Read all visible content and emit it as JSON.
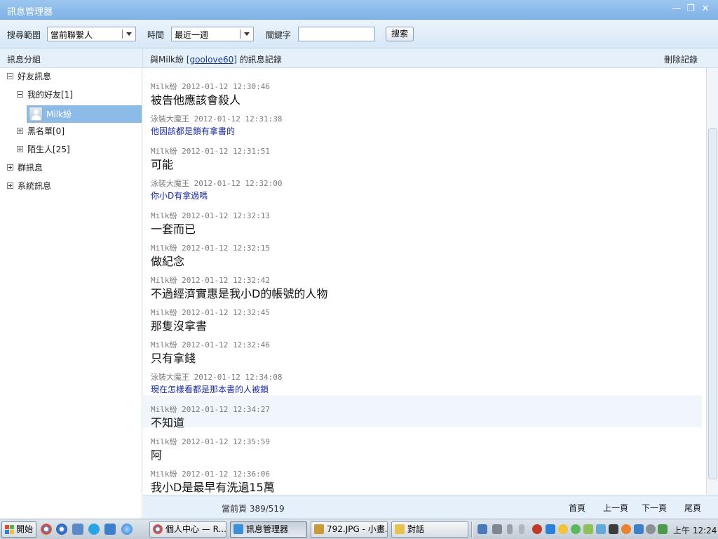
{
  "window": {
    "title": "訊息管理器",
    "minimize": "—",
    "restore": "❐",
    "close": "✕"
  },
  "toolbar": {
    "scope_label": "搜尋範圍",
    "scope_value": "當前聯繫人",
    "time_label": "時間",
    "time_value": "最近一週",
    "keyword_label": "關鍵字",
    "keyword_value": "",
    "search_button": "搜索"
  },
  "sidebar": {
    "header": "訊息分組",
    "tree": {
      "friends": "好友訊息",
      "my_friends": "我的好友[1]",
      "selected_contact": "Milk紛",
      "blacklist": "黑名單[0]",
      "strangers": "陌生人[25]",
      "groups": "群訊息",
      "system": "系統訊息"
    }
  },
  "conversation": {
    "prefix": "與Milk紛",
    "contact_id": "[goolove60]",
    "suffix": "的訊息記錄",
    "delete_button": "刪除記錄"
  },
  "messages": [
    {
      "sender": "Milk紛",
      "time": "2012-01-12 12:30:46",
      "text": "被告他應該會殺人",
      "style": "big"
    },
    {
      "sender": "泳裝大魔王",
      "time": "2012-01-12 12:31:38",
      "text": "他因該都是鎖有拿書的",
      "style": "small"
    },
    {
      "sender": "Milk紛",
      "time": "2012-01-12 12:31:51",
      "text": "可能",
      "style": "big"
    },
    {
      "sender": "泳裝大魔王",
      "time": "2012-01-12 12:32:00",
      "text": "你小D有拿過嗎",
      "style": "small"
    },
    {
      "sender": "Milk紛",
      "time": "2012-01-12 12:32:13",
      "text": "一套而已",
      "style": "big"
    },
    {
      "sender": "Milk紛",
      "time": "2012-01-12 12:32:15",
      "text": "做紀念",
      "style": "big"
    },
    {
      "sender": "Milk紛",
      "time": "2012-01-12 12:32:42",
      "text": "不過經濟實惠是我小D的帳號的人物",
      "style": "big"
    },
    {
      "sender": "Milk紛",
      "time": "2012-01-12 12:32:45",
      "text": "那隻沒拿書",
      "style": "big"
    },
    {
      "sender": "Milk紛",
      "time": "2012-01-12 12:32:46",
      "text": "只有拿錢",
      "style": "big"
    },
    {
      "sender": "泳裝大魔王",
      "time": "2012-01-12 12:34:08",
      "text": "現在怎樣看都是那本書的人被鎖",
      "style": "small"
    },
    {
      "sender": "Milk紛",
      "time": "2012-01-12 12:34:27",
      "text": "不知道",
      "style": "big",
      "highlight": true
    },
    {
      "sender": "Milk紛",
      "time": "2012-01-12 12:35:59",
      "text": "阿",
      "style": "big"
    },
    {
      "sender": "Milk紛",
      "time": "2012-01-12 12:36:06",
      "text": "我小D是最早有洗過15萬",
      "style": "big"
    }
  ],
  "footer": {
    "page_info": "當前頁 389/519",
    "first": "首頁",
    "prev": "上一頁",
    "next": "下一頁",
    "last": "尾頁"
  },
  "taskbar": {
    "start": "開始",
    "tasks": [
      {
        "label": "個人中心 — R...",
        "icon_color": "#e0453a"
      },
      {
        "label": "訊息管理器",
        "icon_color": "#3b8fd9",
        "active": true
      },
      {
        "label": "792.JPG - 小畫...",
        "icon_color": "#c79a3a"
      },
      {
        "label": "對話",
        "icon_color": "#e8c34a"
      }
    ],
    "clock": "上午 12:24"
  }
}
